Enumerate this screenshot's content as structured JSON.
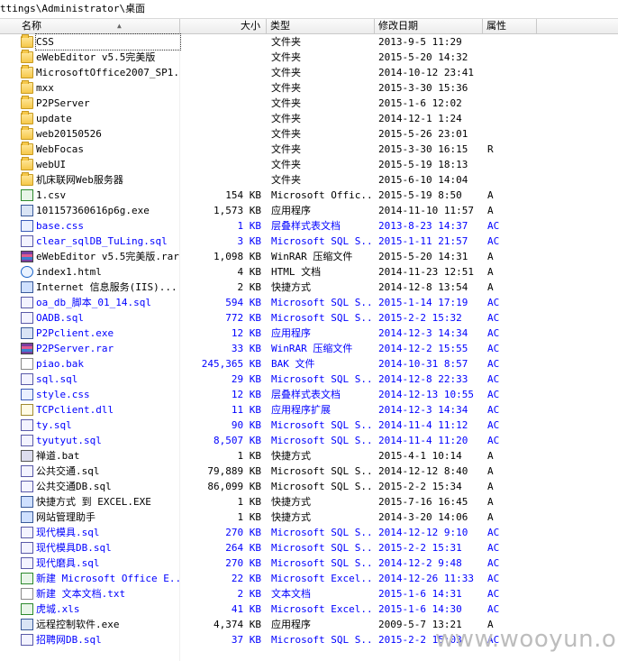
{
  "path": "ttings\\Administrator\\桌面",
  "columns": {
    "name": "名称",
    "size": "大小",
    "type": "类型",
    "date": "修改日期",
    "attr": "属性"
  },
  "rows": [
    {
      "icon": "folder",
      "name": "CSS",
      "size": "",
      "type": "文件夹",
      "date": "2013-9-5 11:29",
      "attr": "",
      "blue": false
    },
    {
      "icon": "folder",
      "name": "eWebEditor v5.5完美版",
      "size": "",
      "type": "文件夹",
      "date": "2015-5-20 14:32",
      "attr": "",
      "blue": false
    },
    {
      "icon": "folder",
      "name": "MicrosoftOffice2007_SP1...",
      "size": "",
      "type": "文件夹",
      "date": "2014-10-12 23:41",
      "attr": "",
      "blue": false
    },
    {
      "icon": "folder",
      "name": "mxx",
      "size": "",
      "type": "文件夹",
      "date": "2015-3-30 15:36",
      "attr": "",
      "blue": false
    },
    {
      "icon": "folder",
      "name": "P2PServer",
      "size": "",
      "type": "文件夹",
      "date": "2015-1-6 12:02",
      "attr": "",
      "blue": false
    },
    {
      "icon": "folder",
      "name": "update",
      "size": "",
      "type": "文件夹",
      "date": "2014-12-1 1:24",
      "attr": "",
      "blue": false
    },
    {
      "icon": "folder",
      "name": "web20150526",
      "size": "",
      "type": "文件夹",
      "date": "2015-5-26 23:01",
      "attr": "",
      "blue": false
    },
    {
      "icon": "folder",
      "name": "WebFocas",
      "size": "",
      "type": "文件夹",
      "date": "2015-3-30 16:15",
      "attr": "R",
      "blue": false
    },
    {
      "icon": "folder",
      "name": "webUI",
      "size": "",
      "type": "文件夹",
      "date": "2015-5-19 18:13",
      "attr": "",
      "blue": false
    },
    {
      "icon": "folder",
      "name": "机床联网Web服务器",
      "size": "",
      "type": "文件夹",
      "date": "2015-6-10 14:04",
      "attr": "",
      "blue": false
    },
    {
      "icon": "xls",
      "name": "1.csv",
      "size": "154 KB",
      "type": "Microsoft Offic...",
      "date": "2015-5-19 8:50",
      "attr": "A",
      "blue": false
    },
    {
      "icon": "exe",
      "name": "101157360616p6g.exe",
      "size": "1,573 KB",
      "type": "应用程序",
      "date": "2014-11-10 11:57",
      "attr": "A",
      "blue": false
    },
    {
      "icon": "css",
      "name": "base.css",
      "size": "1 KB",
      "type": "层叠样式表文档",
      "date": "2013-8-23 14:37",
      "attr": "AC",
      "blue": true
    },
    {
      "icon": "sql",
      "name": "clear_sqlDB_TuLing.sql",
      "size": "3 KB",
      "type": "Microsoft SQL S...",
      "date": "2015-1-11 21:57",
      "attr": "AC",
      "blue": true
    },
    {
      "icon": "rar",
      "name": "eWebEditor v5.5完美版.rar",
      "size": "1,098 KB",
      "type": "WinRAR 压缩文件",
      "date": "2015-5-20 14:31",
      "attr": "A",
      "blue": false
    },
    {
      "icon": "html",
      "name": "index1.html",
      "size": "4 KB",
      "type": "HTML 文档",
      "date": "2014-11-23 12:51",
      "attr": "A",
      "blue": false
    },
    {
      "icon": "lnk",
      "name": "Internet 信息服务(IIS)...",
      "size": "2 KB",
      "type": "快捷方式",
      "date": "2014-12-8 13:54",
      "attr": "A",
      "blue": false
    },
    {
      "icon": "sql",
      "name": "oa_db_脚本_01_14.sql",
      "size": "594 KB",
      "type": "Microsoft SQL S...",
      "date": "2015-1-14 17:19",
      "attr": "AC",
      "blue": true
    },
    {
      "icon": "sql",
      "name": "OADB.sql",
      "size": "772 KB",
      "type": "Microsoft SQL S...",
      "date": "2015-2-2 15:32",
      "attr": "AC",
      "blue": true
    },
    {
      "icon": "exe",
      "name": "P2Pclient.exe",
      "size": "12 KB",
      "type": "应用程序",
      "date": "2014-12-3 14:34",
      "attr": "AC",
      "blue": true
    },
    {
      "icon": "rar",
      "name": "P2PServer.rar",
      "size": "33 KB",
      "type": "WinRAR 压缩文件",
      "date": "2014-12-2 15:55",
      "attr": "AC",
      "blue": true
    },
    {
      "icon": "bak",
      "name": "piao.bak",
      "size": "245,365 KB",
      "type": "BAK 文件",
      "date": "2014-10-31 8:57",
      "attr": "AC",
      "blue": true
    },
    {
      "icon": "sql",
      "name": "sql.sql",
      "size": "29 KB",
      "type": "Microsoft SQL S...",
      "date": "2014-12-8 22:33",
      "attr": "AC",
      "blue": true
    },
    {
      "icon": "css",
      "name": "style.css",
      "size": "12 KB",
      "type": "层叠样式表文档",
      "date": "2014-12-13 10:55",
      "attr": "AC",
      "blue": true
    },
    {
      "icon": "dll",
      "name": "TCPclient.dll",
      "size": "11 KB",
      "type": "应用程序扩展",
      "date": "2014-12-3 14:34",
      "attr": "AC",
      "blue": true
    },
    {
      "icon": "sql",
      "name": "ty.sql",
      "size": "90 KB",
      "type": "Microsoft SQL S...",
      "date": "2014-11-4 11:12",
      "attr": "AC",
      "blue": true
    },
    {
      "icon": "sql",
      "name": "tyutyut.sql",
      "size": "8,507 KB",
      "type": "Microsoft SQL S...",
      "date": "2014-11-4 11:20",
      "attr": "AC",
      "blue": true
    },
    {
      "icon": "bat",
      "name": "禅道.bat",
      "size": "1 KB",
      "type": "快捷方式",
      "date": "2015-4-1 10:14",
      "attr": "A",
      "blue": false
    },
    {
      "icon": "sql",
      "name": "公共交通.sql",
      "size": "79,889 KB",
      "type": "Microsoft SQL S...",
      "date": "2014-12-12 8:40",
      "attr": "A",
      "blue": false
    },
    {
      "icon": "sql",
      "name": "公共交通DB.sql",
      "size": "86,099 KB",
      "type": "Microsoft SQL S...",
      "date": "2015-2-2 15:34",
      "attr": "A",
      "blue": false
    },
    {
      "icon": "lnk",
      "name": "快捷方式 到 EXCEL.EXE",
      "size": "1 KB",
      "type": "快捷方式",
      "date": "2015-7-16 16:45",
      "attr": "A",
      "blue": false
    },
    {
      "icon": "lnk",
      "name": "网站管理助手",
      "size": "1 KB",
      "type": "快捷方式",
      "date": "2014-3-20 14:06",
      "attr": "A",
      "blue": false
    },
    {
      "icon": "sql",
      "name": "现代模具.sql",
      "size": "270 KB",
      "type": "Microsoft SQL S...",
      "date": "2014-12-12 9:10",
      "attr": "AC",
      "blue": true
    },
    {
      "icon": "sql",
      "name": "现代模具DB.sql",
      "size": "264 KB",
      "type": "Microsoft SQL S...",
      "date": "2015-2-2 15:31",
      "attr": "AC",
      "blue": true
    },
    {
      "icon": "sql",
      "name": "现代磨具.sql",
      "size": "270 KB",
      "type": "Microsoft SQL S...",
      "date": "2014-12-2 9:48",
      "attr": "AC",
      "blue": true
    },
    {
      "icon": "xls",
      "name": "新建 Microsoft Office E...",
      "size": "22 KB",
      "type": "Microsoft Excel...",
      "date": "2014-12-26 11:33",
      "attr": "AC",
      "blue": true
    },
    {
      "icon": "txt",
      "name": "新建 文本文档.txt",
      "size": "2 KB",
      "type": "文本文档",
      "date": "2015-1-6 14:31",
      "attr": "AC",
      "blue": true
    },
    {
      "icon": "xls",
      "name": "虎城.xls",
      "size": "41 KB",
      "type": "Microsoft Excel...",
      "date": "2015-1-6 14:30",
      "attr": "AC",
      "blue": true
    },
    {
      "icon": "exe",
      "name": "远程控制软件.exe",
      "size": "4,374 KB",
      "type": "应用程序",
      "date": "2009-5-7 13:21",
      "attr": "A",
      "blue": false
    },
    {
      "icon": "sql",
      "name": "招聘网DB.sql",
      "size": "37 KB",
      "type": "Microsoft SQL S...",
      "date": "2015-2-2 15:03",
      "attr": "AC",
      "blue": true
    }
  ],
  "watermark": "www.wooyun.org"
}
